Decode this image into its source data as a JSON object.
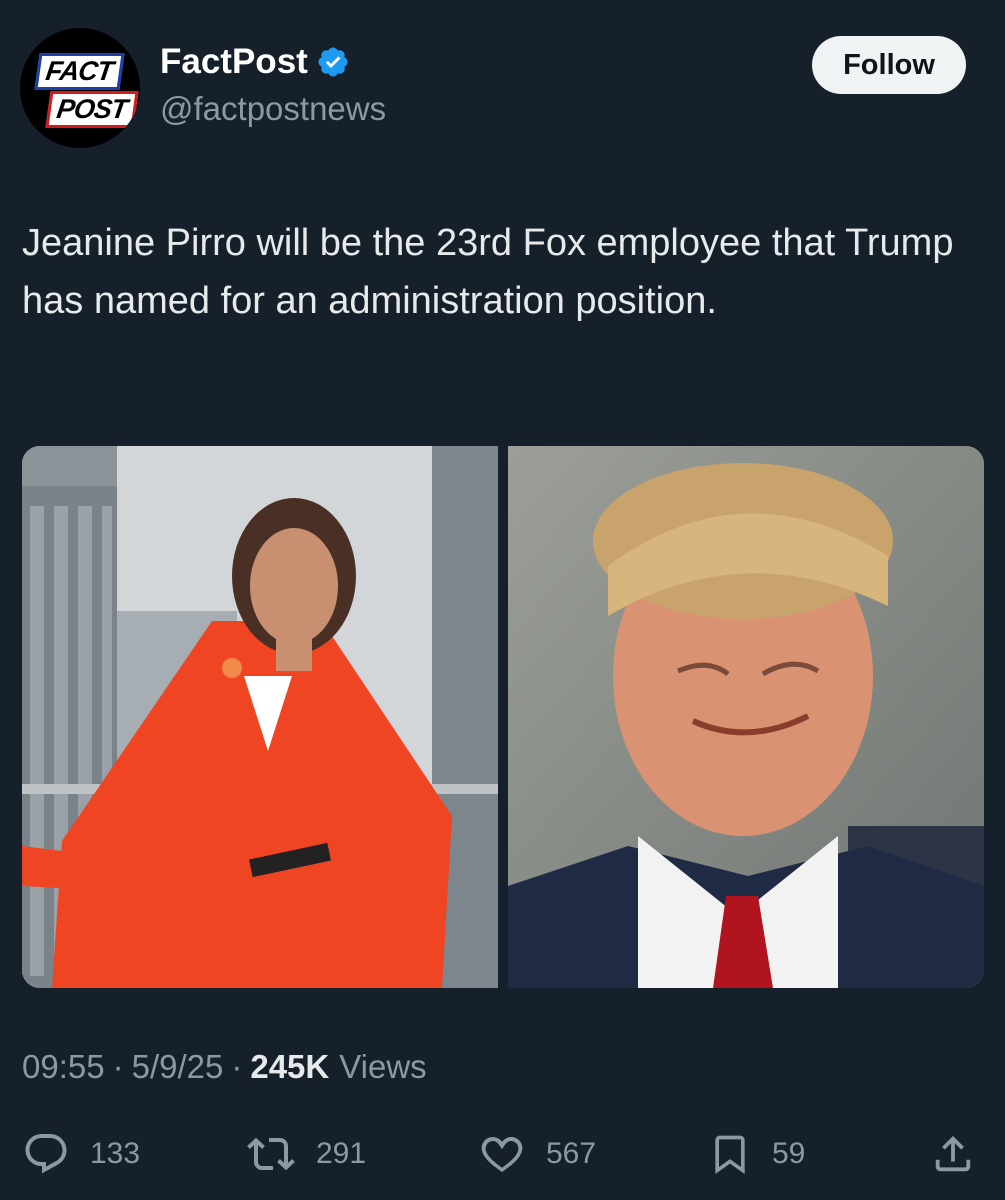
{
  "author": {
    "display_name": "FactPost",
    "handle": "@factpostnews",
    "avatar_logo": [
      "FACT",
      "POST"
    ],
    "verified": true
  },
  "follow_label": "Follow",
  "tweet": {
    "text": "Jeanine Pirro will be the 23rd Fox employee that Trump has named for an administration position."
  },
  "media": [
    {
      "icon": "photo-woman-orange-suit"
    },
    {
      "icon": "photo-man-red-tie"
    }
  ],
  "meta": {
    "time": "09:55",
    "date": "5/9/25",
    "views_count": "245K",
    "views_label": "Views"
  },
  "actions": {
    "replies": "133",
    "retweets": "291",
    "likes": "567",
    "bookmarks": "59"
  },
  "colors": {
    "background": "#15202b",
    "muted_text": "#8b98a5",
    "verified_blue": "#1d9bf0",
    "follow_bg": "#eff3f4"
  }
}
